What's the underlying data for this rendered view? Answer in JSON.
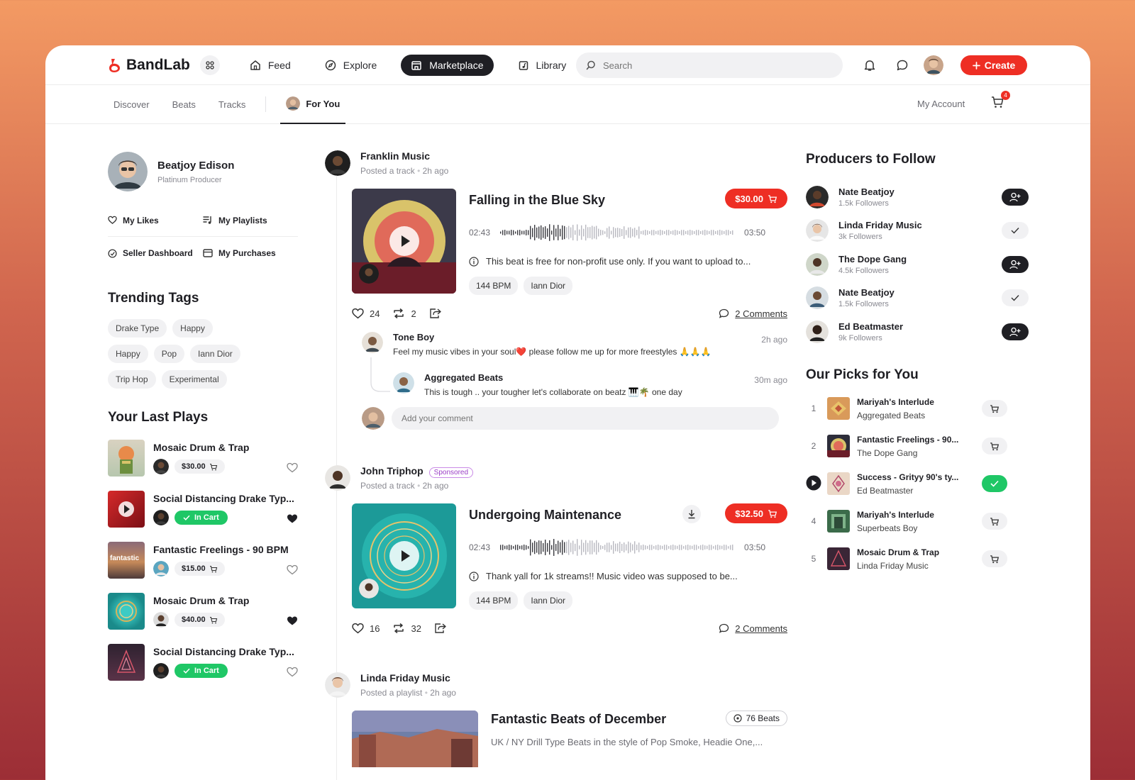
{
  "app": {
    "name": "BandLab"
  },
  "nav": {
    "items": [
      {
        "label": "Feed",
        "icon": "home-icon"
      },
      {
        "label": "Explore",
        "icon": "compass-icon"
      },
      {
        "label": "Marketplace",
        "icon": "store-icon",
        "active": true
      },
      {
        "label": "Library",
        "icon": "library-icon"
      }
    ],
    "search_placeholder": "Search",
    "create_label": "Create"
  },
  "subnav": {
    "tabs": [
      "Discover",
      "Beats",
      "Tracks"
    ],
    "active_tab": "For You",
    "account_label": "My Account",
    "cart_count": "4"
  },
  "profile": {
    "name": "Beatjoy Edison",
    "role": "Platinum Producer",
    "links": [
      "My Likes",
      "My Playlists",
      "Seller Dashboard",
      "My Purchases"
    ]
  },
  "trending": {
    "title": "Trending Tags",
    "tags": [
      "Drake Type",
      "Happy",
      "Happy",
      "Pop",
      "Iann Dior",
      "Trip Hop",
      "Experimental"
    ]
  },
  "last_plays": {
    "title": "Your Last Plays",
    "items": [
      {
        "title": "Mosaic Drum & Trap",
        "price": "$30.00",
        "in_cart": false,
        "liked": false
      },
      {
        "title": "Social Distancing Drake Typ...",
        "price": "In Cart",
        "in_cart": true,
        "liked": true
      },
      {
        "title": "Fantastic Freelings - 90 BPM",
        "price": "$15.00",
        "in_cart": false,
        "liked": false,
        "thumb_label": "fantastic"
      },
      {
        "title": "Mosaic Drum & Trap",
        "price": "$40.00",
        "in_cart": false,
        "liked": true
      },
      {
        "title": "Social Distancing Drake Typ...",
        "price": "In Cart",
        "in_cart": true,
        "liked": false
      }
    ]
  },
  "feed": {
    "posts": [
      {
        "author": "Franklin Music",
        "action": "Posted a track",
        "time": "2h ago",
        "track_title": "Falling in the Blue Sky",
        "price": "$30.00",
        "elapsed": "02:43",
        "duration": "03:50",
        "description": "This beat is free for non-profit use only. If you want to upload to...",
        "chips": [
          "144 BPM",
          "Iann Dior"
        ],
        "likes": "24",
        "reposts": "2",
        "comments_label": "2 Comments",
        "comments": [
          {
            "name": "Tone Boy",
            "text": "Feel my music vibes in your soul❤️ please follow me up for more freestyles 🙏🙏🙏",
            "time": "2h ago"
          },
          {
            "name": "Aggregated Beats",
            "text": "This is tough .. your tougher let's collaborate on beatz 🎹🌴 one day",
            "time": "30m ago"
          }
        ],
        "comment_placeholder": "Add your comment"
      },
      {
        "author": "John Triphop",
        "badge": "Sponsored",
        "action": "Posted a track",
        "time": "2h ago",
        "track_title": "Undergoing Maintenance",
        "price": "$32.50",
        "elapsed": "02:43",
        "duration": "03:50",
        "description": "Thank yall for 1k streams!! Music video was supposed to be...",
        "chips": [
          "144 BPM",
          "Iann Dior"
        ],
        "likes": "16",
        "reposts": "32",
        "comments_label": "2 Comments"
      },
      {
        "author": "Linda Friday Music",
        "action": "Posted a playlist",
        "time": "2h ago",
        "playlist_title": "Fantastic Beats of December",
        "beats_count": "76 Beats",
        "description": "UK / NY Drill Type Beats in the style of Pop Smoke, Headie One,..."
      }
    ]
  },
  "producers": {
    "title": "Producers to Follow",
    "items": [
      {
        "name": "Nate Beatjoy",
        "followers": "1.5k Followers",
        "following": false
      },
      {
        "name": "Linda Friday Music",
        "followers": "3k Followers",
        "following": true
      },
      {
        "name": "The Dope Gang",
        "followers": "4.5k Followers",
        "following": false
      },
      {
        "name": "Nate Beatjoy",
        "followers": "1.5k Followers",
        "following": true
      },
      {
        "name": "Ed Beatmaster",
        "followers": "9k Followers",
        "following": false
      }
    ]
  },
  "picks": {
    "title": "Our Picks for You",
    "items": [
      {
        "rank": "1",
        "title": "Mariyah's Interlude",
        "artist": "Aggregated Beats",
        "in_cart": false
      },
      {
        "rank": "2",
        "title": "Fantastic Freelings - 90...",
        "artist": "The Dope Gang",
        "in_cart": false
      },
      {
        "rank": "",
        "title": "Success - Grityy 90's ty...",
        "artist": "Ed Beatmaster",
        "in_cart": true,
        "playing": true
      },
      {
        "rank": "4",
        "title": "Mariyah's Interlude",
        "artist": "Superbeats Boy",
        "in_cart": false
      },
      {
        "rank": "5",
        "title": "Mosaic Drum & Trap",
        "artist": "Linda Friday Music",
        "in_cart": false
      }
    ]
  },
  "colors": {
    "accent": "#ee2e24",
    "success": "#1fc766",
    "dark": "#1f1f24"
  }
}
